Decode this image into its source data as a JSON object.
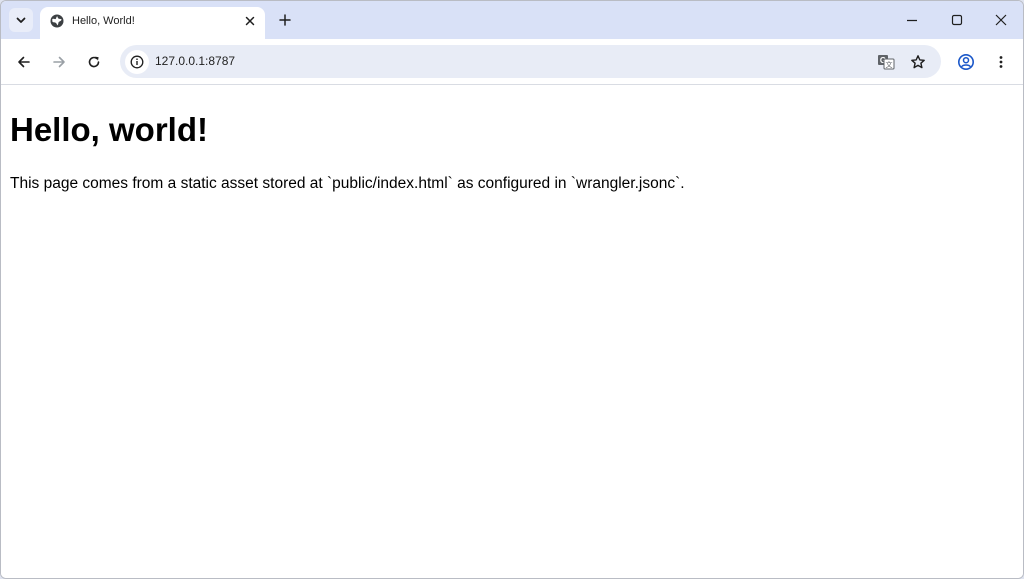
{
  "browser": {
    "tabs": [
      {
        "title": "Hello, World!",
        "favicon": "globe-icon",
        "active": true
      }
    ],
    "address_bar": {
      "url": "127.0.0.1:8787",
      "site_info_icon": "info-icon"
    },
    "toolbar_icons": [
      "back-arrow-icon",
      "forward-arrow-icon",
      "reload-icon",
      "translate-icon",
      "bookmark-star-icon",
      "profile-icon",
      "more-menu-icon"
    ],
    "window_controls": [
      "minimize-icon",
      "maximize-icon",
      "close-icon"
    ]
  },
  "page": {
    "heading": "Hello, world!",
    "paragraph": "This page comes from a static asset stored at `public/index.html` as configured in `wrangler.jsonc`."
  },
  "colors": {
    "tabstrip_bg": "#d9e1f7",
    "omnibox_bg": "#e8ecf6",
    "profile_accent": "#1a57c9"
  }
}
